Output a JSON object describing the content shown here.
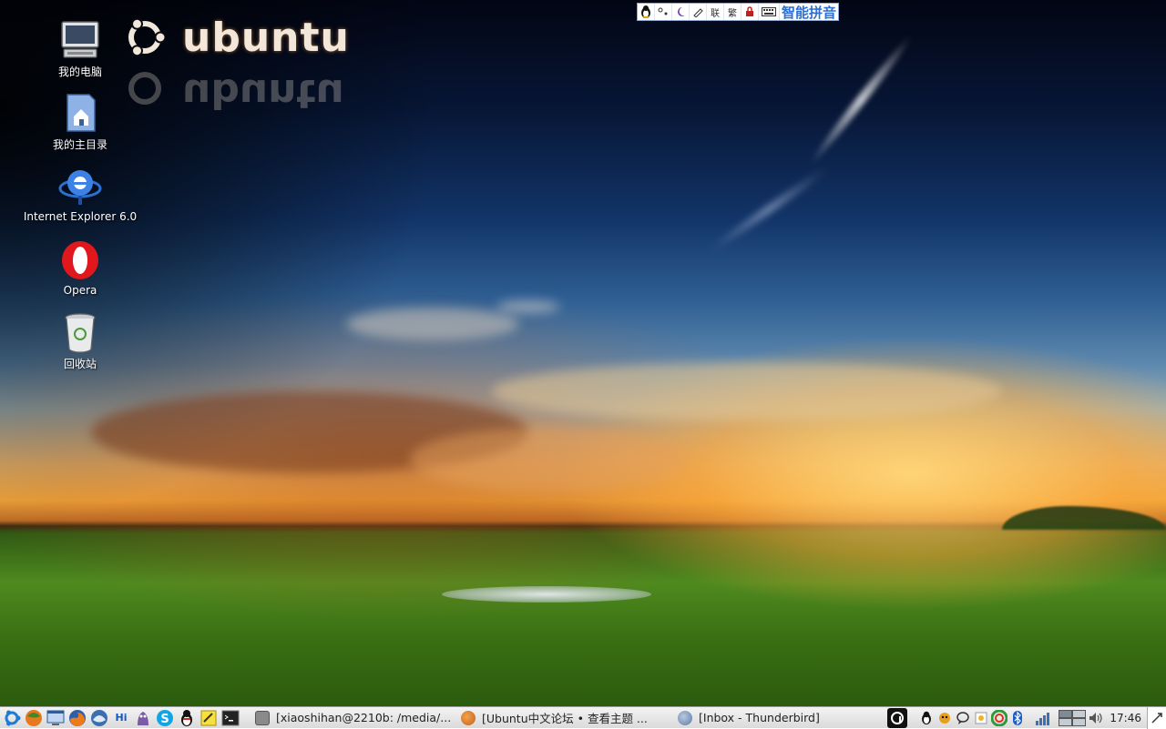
{
  "desktop": {
    "logo_text": "ubuntu",
    "icons": [
      {
        "label": "我的电脑",
        "icon": "computer-icon"
      },
      {
        "label": "我的主目录",
        "icon": "home-folder-icon"
      },
      {
        "label": "Internet Explorer 6.0",
        "icon": "internet-explorer-icon"
      },
      {
        "label": "Opera",
        "icon": "opera-icon"
      },
      {
        "label": "回收站",
        "icon": "trash-icon"
      }
    ]
  },
  "ime": {
    "name": "智能拼音",
    "buttons": [
      "penguin-icon",
      "punctuation",
      "moon",
      "pen",
      "联",
      "繁",
      "lock",
      "keyboard"
    ],
    "link_label": "联",
    "trad_label": "繁"
  },
  "taskbar": {
    "launchers": [
      "start-icon",
      "firefox-ball-icon",
      "show-desktop-icon",
      "firefox-icon",
      "thunderbird-icon",
      "hi-icon",
      "pidgin-icon",
      "skype-icon",
      "qq-icon",
      "notes-icon",
      "terminal-icon"
    ],
    "hi_label": "Hi",
    "tasks": [
      {
        "label": "[xiaoshihan@2210b: /media/...",
        "icon": "terminal-window-icon"
      },
      {
        "label": "[Ubuntu中文论坛 • 查看主题 ...",
        "icon": "firefox-window-icon"
      },
      {
        "label": "[Inbox - Thunderbird]",
        "icon": "thunderbird-window-icon"
      }
    ],
    "tray": {
      "clock": "17:46",
      "icons": [
        "amarok-icon",
        "qq-tray-icon",
        "pidgin-tray-icon",
        "chat-tray-icon",
        "notes-tray-icon",
        "network-tray-icon",
        "bluetooth-icon",
        "signal-icon",
        "workspace-switcher-icon",
        "volume-icon"
      ]
    }
  },
  "colors": {
    "ime_text": "#2e6fd0",
    "taskbar_bg": "#e6e6e6"
  }
}
